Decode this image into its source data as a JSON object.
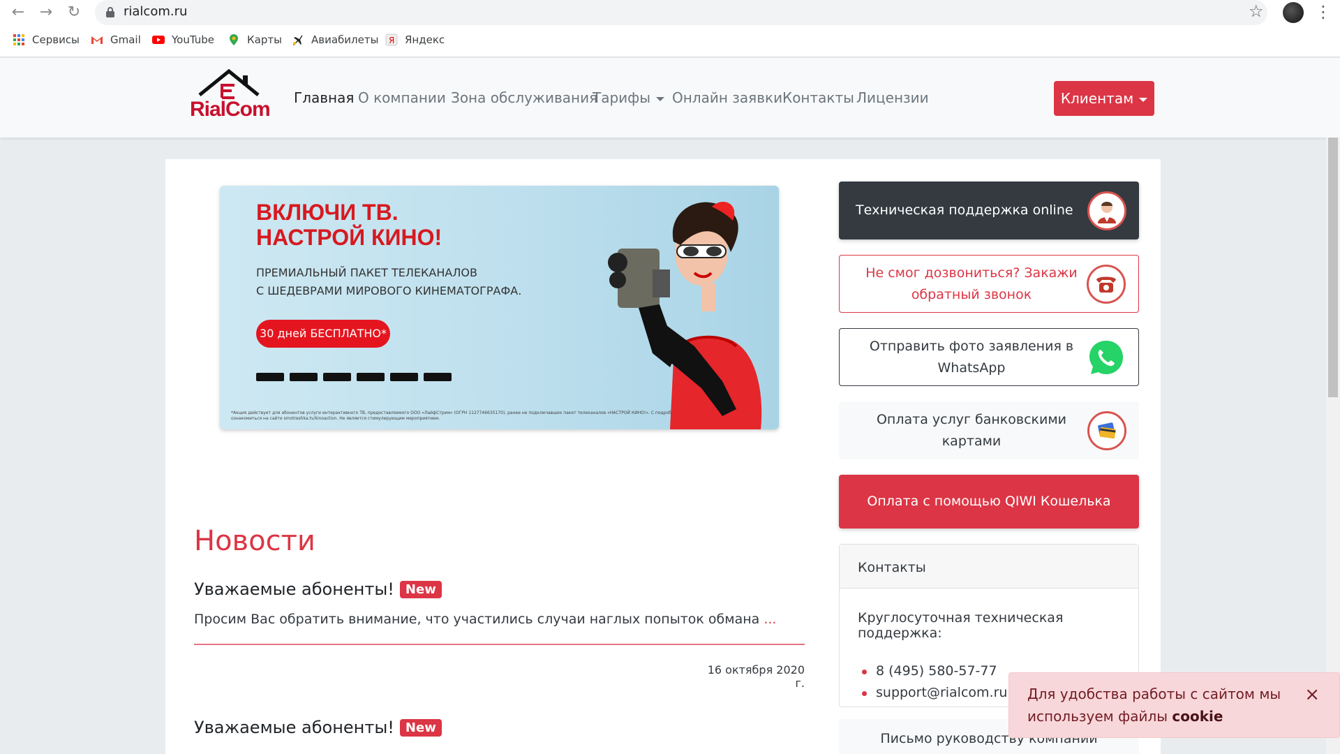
{
  "browser": {
    "url": "rialcom.ru",
    "bookmarks": [
      "Сервисы",
      "Gmail",
      "YouTube",
      "Карты",
      "Авиабилеты",
      "Яндекс"
    ]
  },
  "site": {
    "logo": "RialCom",
    "nav": [
      "Главная",
      "О компании",
      "Зона обслуживания",
      "Тарифы",
      "Онлайн заявки",
      "Контакты",
      "Лицензии"
    ],
    "clients_button": "Клиентам"
  },
  "banner": {
    "title_line1": "ВКЛЮЧИ ТВ.",
    "title_line2": "НАСТРОЙ КИНО!",
    "subtitle_line1": "ПРЕМИАЛЬНЫЙ ПАКЕТ ТЕЛЕКАНАЛОВ",
    "subtitle_line2": "С ШЕДЕВРАМИ МИРОВОГО КИНЕМАТОГРАФА.",
    "pill": "30 дней БЕСПЛАТНО*",
    "footnote": "*Акция действует для абонентов услуги интерактивного ТВ, предоставляемого ООО «ЛайфСтрим» (ОГРН 1127746635170), ранее не подключавших пакет телеканалов «НАСТРОЙ КИНО!». С подробными условиями акции можно ознакомиться на сайте smotreshka.tv/kinoaction. Не является стимулирующим мероприятием."
  },
  "sidebar": {
    "support": "Техническая поддержка online",
    "callback": "Не смог дозвониться? Закажи обратный звонок",
    "whatsapp": "Отправить фото заявления в WhatsApp",
    "cards": "Оплата услуг банковскими картами",
    "qiwi": "Оплата с помощью QIWI Кошелька",
    "contacts_title": "Контакты",
    "contacts_support": "Круглосуточная техническая поддержка:",
    "phone": "8 (495) 580-57-77",
    "email": "support@rialcom.ru",
    "letter": "Письмо руководству компании"
  },
  "news": {
    "title": "Новости",
    "items": [
      {
        "heading": "Уважаемые абоненты!",
        "badge": "New",
        "text": "Просим Вас обратить внимание, что участились случаи наглых попыток обмана",
        "more": "...",
        "date": "16 октября 2020 г."
      },
      {
        "heading": "Уважаемые абоненты!",
        "badge": "New"
      }
    ]
  },
  "cookie": {
    "text": "Для удобства работы с сайтом мы используем файлы",
    "bold": "cookie",
    "close": "×"
  },
  "colors": {
    "accent": "#dc3545",
    "dark": "#343a40",
    "whatsapp": "#25d366"
  }
}
